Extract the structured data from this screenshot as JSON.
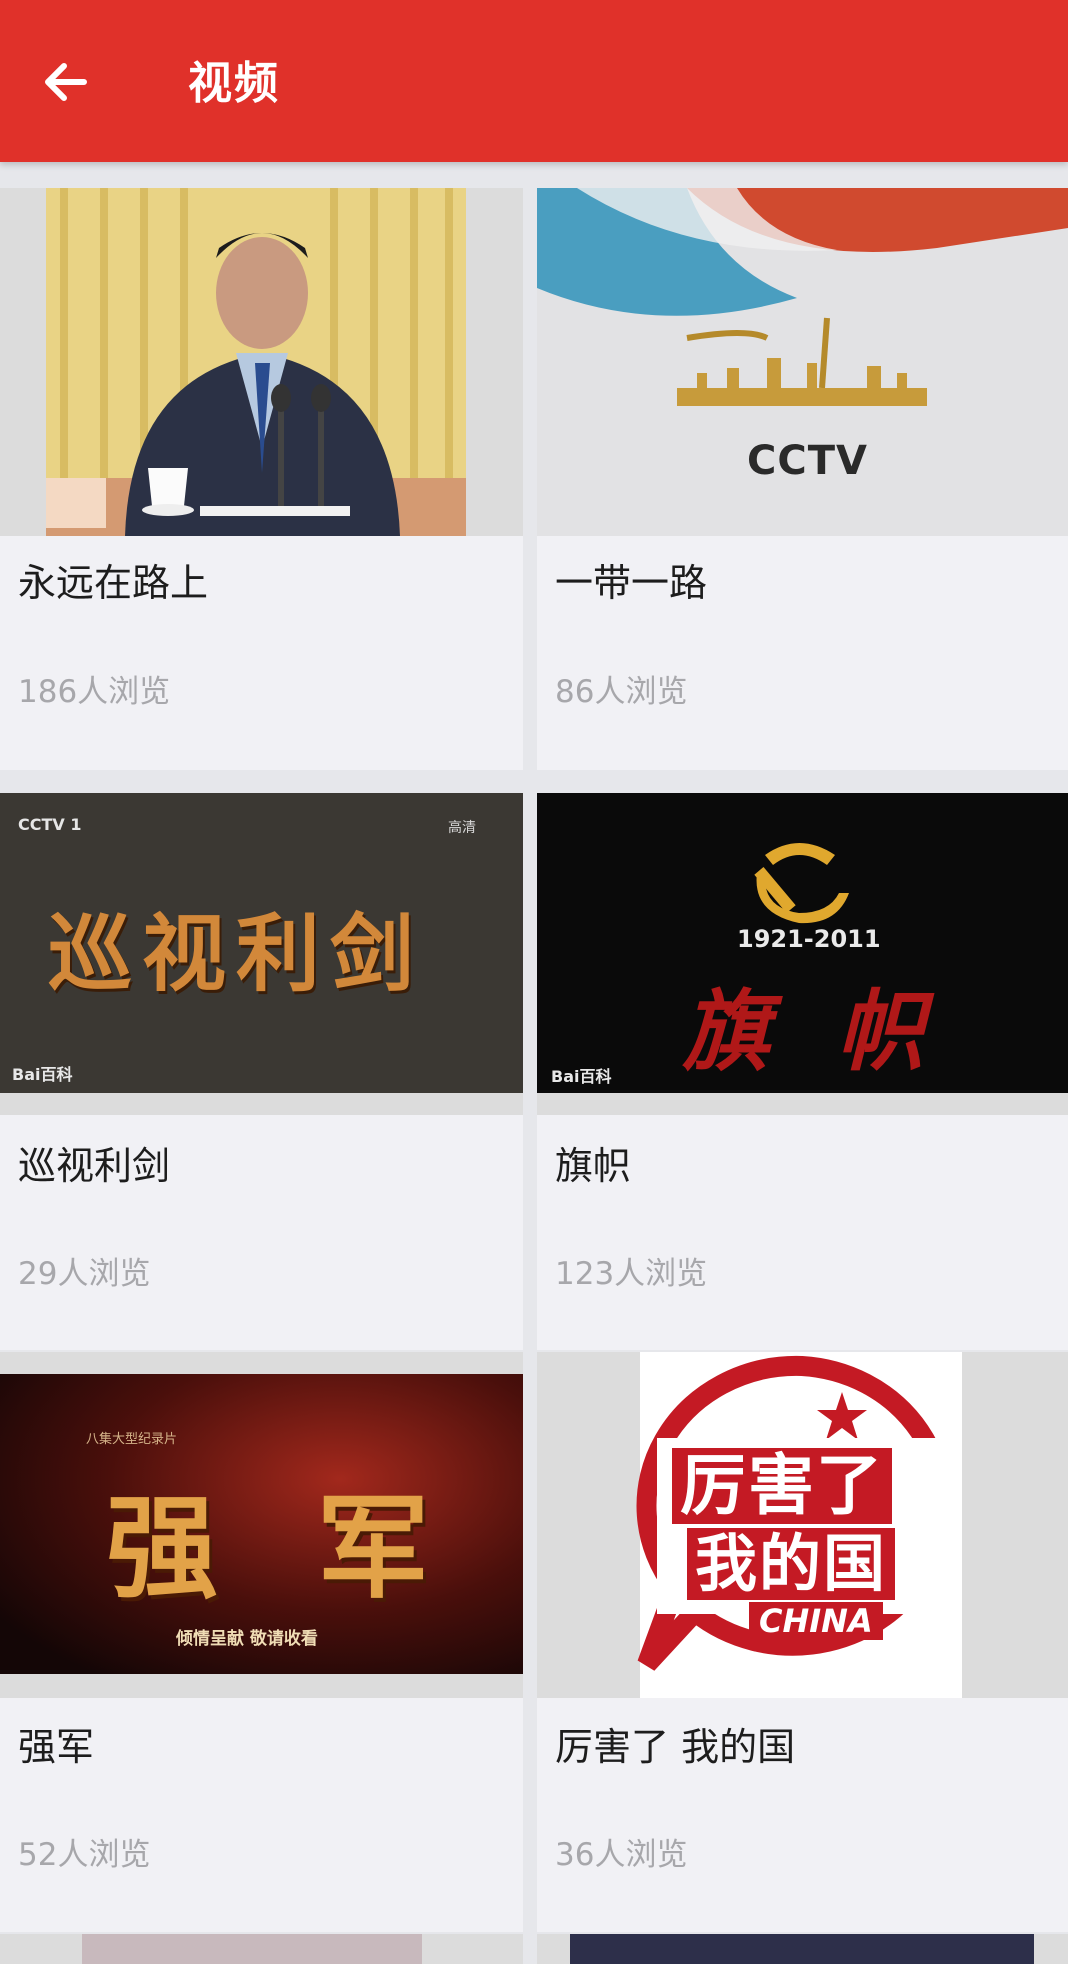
{
  "header": {
    "title": "视频",
    "back_icon": "arrow-left-icon"
  },
  "colors": {
    "appbar": "#e0312a",
    "card_bg": "#f1f1f5",
    "page_bg": "#e6e7eb",
    "views_text": "#a7a7ab"
  },
  "videos": [
    {
      "title": "永远在路上",
      "views": "186人浏览"
    },
    {
      "title": "一带一路",
      "views": "86人浏览",
      "thumb_text": "CCTV"
    },
    {
      "title": "巡视利剑",
      "views": "29人浏览",
      "thumb_text": "巡视利剑",
      "watermark": "Bai百科",
      "channel": "CCTV 1",
      "quality": "高清"
    },
    {
      "title": "旗帜",
      "views": "123人浏览",
      "thumb_text": "旗 帜",
      "year_range": "1921-2011",
      "watermark": "Bai百科"
    },
    {
      "title": "强军",
      "views": "52人浏览",
      "thumb_text": "强 军",
      "tagline": "倾情呈献 敬请收看",
      "series": "八集大型纪录片"
    },
    {
      "title": "厉害了 我的国",
      "views": "36人浏览",
      "thumb_line1": "厉害了",
      "thumb_line2": "我的国",
      "thumb_line3": "CHINA"
    }
  ]
}
